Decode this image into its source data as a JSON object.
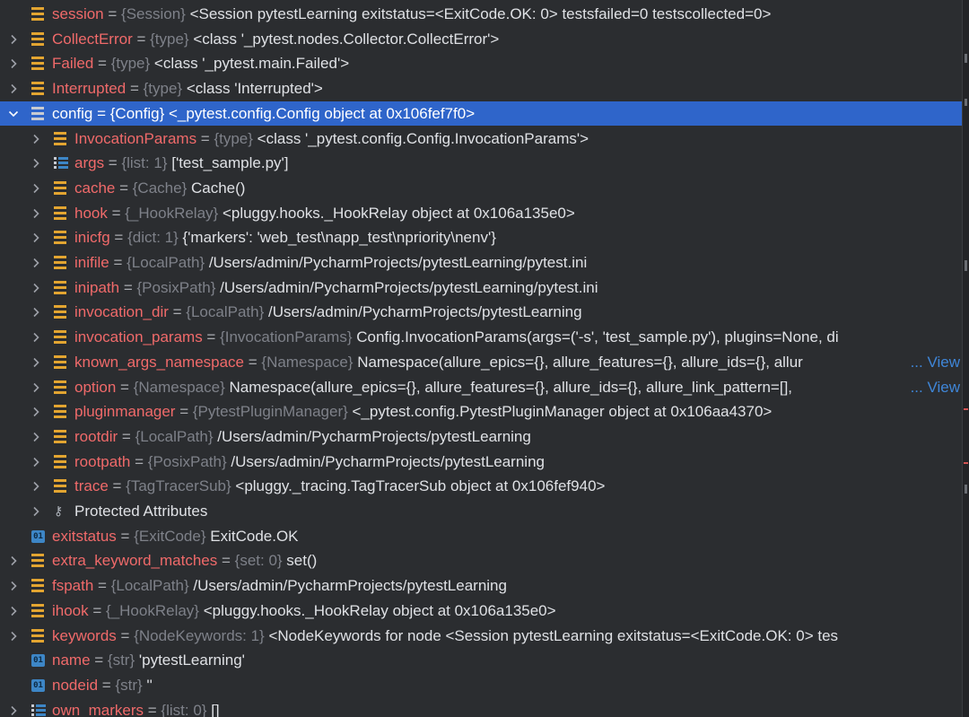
{
  "rows": [
    {
      "depth": 0,
      "chevron": "",
      "icon": "field-icon",
      "name": "session",
      "eq": " = ",
      "type": "{Session}",
      "value": " <Session pytestLearning exitstatus=<ExitCode.OK: 0> testsfailed=0 testscollected=0>"
    },
    {
      "depth": 0,
      "chevron": ">",
      "icon": "field-icon",
      "name": "CollectError",
      "eq": " = ",
      "type": "{type}",
      "value": " <class '_pytest.nodes.Collector.CollectError'>"
    },
    {
      "depth": 0,
      "chevron": ">",
      "icon": "field-icon",
      "name": "Failed",
      "eq": " = ",
      "type": "{type}",
      "value": " <class '_pytest.main.Failed'>"
    },
    {
      "depth": 0,
      "chevron": ">",
      "icon": "field-icon",
      "name": "Interrupted",
      "eq": " = ",
      "type": "{type}",
      "value": " <class 'Interrupted'>"
    },
    {
      "depth": 0,
      "chevron": "v",
      "icon": "field-icon",
      "name": "config",
      "eq": " = ",
      "type": "{Config}",
      "value": " <_pytest.config.Config object at 0x106fef7f0>",
      "selected": true
    },
    {
      "depth": 1,
      "chevron": ">",
      "icon": "field-icon",
      "name": "InvocationParams",
      "eq": " = ",
      "type": "{type}",
      "value": " <class '_pytest.config.Config.InvocationParams'>"
    },
    {
      "depth": 1,
      "chevron": ">",
      "icon": "list-icon",
      "name": "args",
      "eq": " = ",
      "type": "{list: 1}",
      "value": " ['test_sample.py']"
    },
    {
      "depth": 1,
      "chevron": ">",
      "icon": "field-icon",
      "name": "cache",
      "eq": " = ",
      "type": "{Cache}",
      "value": " Cache()"
    },
    {
      "depth": 1,
      "chevron": ">",
      "icon": "field-icon",
      "name": "hook",
      "eq": " = ",
      "type": "{_HookRelay}",
      "value": " <pluggy.hooks._HookRelay object at 0x106a135e0>"
    },
    {
      "depth": 1,
      "chevron": ">",
      "icon": "field-icon",
      "name": "inicfg",
      "eq": " = ",
      "type": "{dict: 1}",
      "value": " {'markers': 'web_test\\napp_test\\npriority\\nenv'}"
    },
    {
      "depth": 1,
      "chevron": ">",
      "icon": "field-icon",
      "name": "inifile",
      "eq": " = ",
      "type": "{LocalPath}",
      "value": " /Users/admin/PycharmProjects/pytestLearning/pytest.ini"
    },
    {
      "depth": 1,
      "chevron": ">",
      "icon": "field-icon",
      "name": "inipath",
      "eq": " = ",
      "type": "{PosixPath}",
      "value": " /Users/admin/PycharmProjects/pytestLearning/pytest.ini"
    },
    {
      "depth": 1,
      "chevron": ">",
      "icon": "field-icon",
      "name": "invocation_dir",
      "eq": " = ",
      "type": "{LocalPath}",
      "value": " /Users/admin/PycharmProjects/pytestLearning"
    },
    {
      "depth": 1,
      "chevron": ">",
      "icon": "field-icon",
      "name": "invocation_params",
      "eq": " = ",
      "type": "{InvocationParams}",
      "value": " Config.InvocationParams(args=('-s', 'test_sample.py'), plugins=None, di"
    },
    {
      "depth": 1,
      "chevron": ">",
      "icon": "field-icon",
      "name": "known_args_namespace",
      "eq": " = ",
      "type": "{Namespace}",
      "value": " Namespace(allure_epics={}, allure_features={}, allure_ids={}, allur",
      "view": "... View"
    },
    {
      "depth": 1,
      "chevron": ">",
      "icon": "field-icon",
      "name": "option",
      "eq": " = ",
      "type": "{Namespace}",
      "value": " Namespace(allure_epics={}, allure_features={}, allure_ids={}, allure_link_pattern=[], ",
      "view": "... View"
    },
    {
      "depth": 1,
      "chevron": ">",
      "icon": "field-icon",
      "name": "pluginmanager",
      "eq": " = ",
      "type": "{PytestPluginManager}",
      "value": " <_pytest.config.PytestPluginManager object at 0x106aa4370>"
    },
    {
      "depth": 1,
      "chevron": ">",
      "icon": "field-icon",
      "name": "rootdir",
      "eq": " = ",
      "type": "{LocalPath}",
      "value": " /Users/admin/PycharmProjects/pytestLearning"
    },
    {
      "depth": 1,
      "chevron": ">",
      "icon": "field-icon",
      "name": "rootpath",
      "eq": " = ",
      "type": "{PosixPath}",
      "value": " /Users/admin/PycharmProjects/pytestLearning"
    },
    {
      "depth": 1,
      "chevron": ">",
      "icon": "field-icon",
      "name": "trace",
      "eq": " = ",
      "type": "{TagTracerSub}",
      "value": " <pluggy._tracing.TagTracerSub object at 0x106fef940>"
    },
    {
      "depth": 1,
      "chevron": ">",
      "icon": "key-icon",
      "plain": "Protected Attributes"
    },
    {
      "depth": 0,
      "chevron": "",
      "icon": "primitive-icon",
      "name": "exitstatus",
      "eq": " = ",
      "type": "{ExitCode}",
      "value": " ExitCode.OK"
    },
    {
      "depth": 0,
      "chevron": ">",
      "icon": "field-icon",
      "name": "extra_keyword_matches",
      "eq": " = ",
      "type": "{set: 0}",
      "value": " set()"
    },
    {
      "depth": 0,
      "chevron": ">",
      "icon": "field-icon",
      "name": "fspath",
      "eq": " = ",
      "type": "{LocalPath}",
      "value": " /Users/admin/PycharmProjects/pytestLearning"
    },
    {
      "depth": 0,
      "chevron": ">",
      "icon": "field-icon",
      "name": "ihook",
      "eq": " = ",
      "type": "{_HookRelay}",
      "value": " <pluggy.hooks._HookRelay object at 0x106a135e0>"
    },
    {
      "depth": 0,
      "chevron": ">",
      "icon": "field-icon",
      "name": "keywords",
      "eq": " = ",
      "type": "{NodeKeywords: 1}",
      "value": " <NodeKeywords for node <Session pytestLearning exitstatus=<ExitCode.OK: 0> tes"
    },
    {
      "depth": 0,
      "chevron": "",
      "icon": "primitive-icon",
      "name": "name",
      "eq": " = ",
      "type": "{str}",
      "value": " 'pytestLearning'"
    },
    {
      "depth": 0,
      "chevron": "",
      "icon": "primitive-icon",
      "name": "nodeid",
      "eq": " = ",
      "type": "{str}",
      "value": " ''"
    },
    {
      "depth": 0,
      "chevron": ">",
      "icon": "list-icon",
      "name": "own_markers",
      "eq": " = ",
      "type": "{list: 0}",
      "value": " []"
    }
  ],
  "icons": {
    "primitive_glyph": "01",
    "key_glyph": "⚷",
    "field_color": "#e3a531",
    "selection_color": "#2f65ca",
    "name_color": "#f06a6a"
  }
}
